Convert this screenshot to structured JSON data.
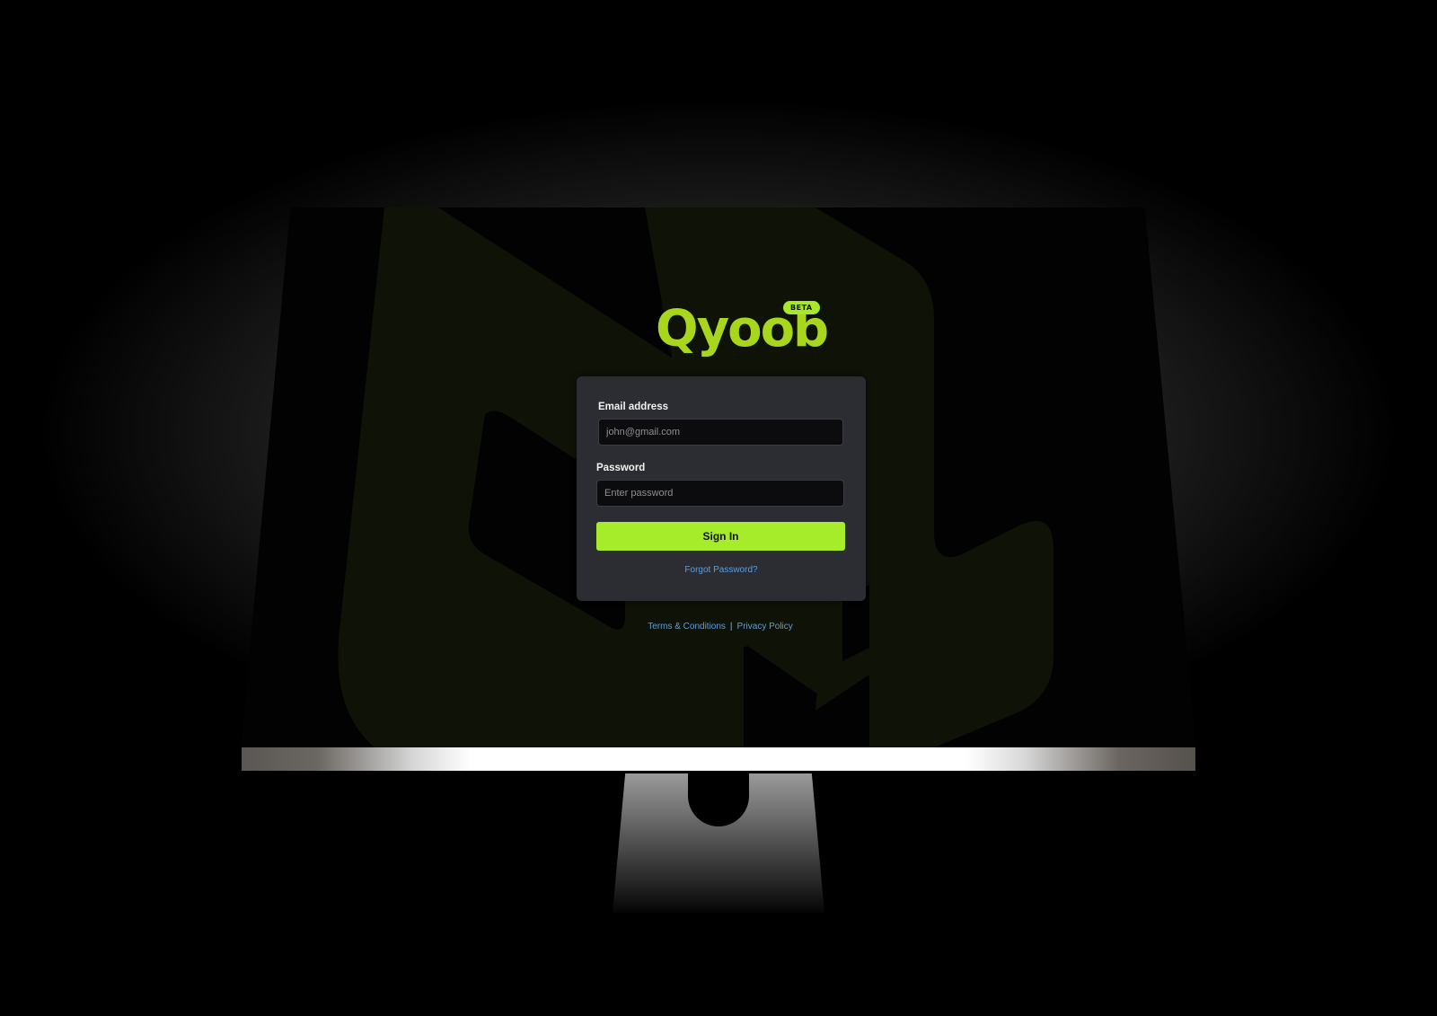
{
  "brand": {
    "name": "Qyoob",
    "badge": "BETA"
  },
  "login": {
    "email_label": "Email address",
    "email_placeholder": "john@gmail.com",
    "password_label": "Password",
    "password_placeholder": "Enter password",
    "signin_label": "Sign In",
    "forgot_label": "Forgot Password?"
  },
  "footer": {
    "terms_label": "Terms & Conditions",
    "separator": "|",
    "privacy_label": "Privacy Policy"
  },
  "colors": {
    "accent": "#a8e82a",
    "card_bg": "#2b2d32",
    "link": "#5c9ee6"
  }
}
